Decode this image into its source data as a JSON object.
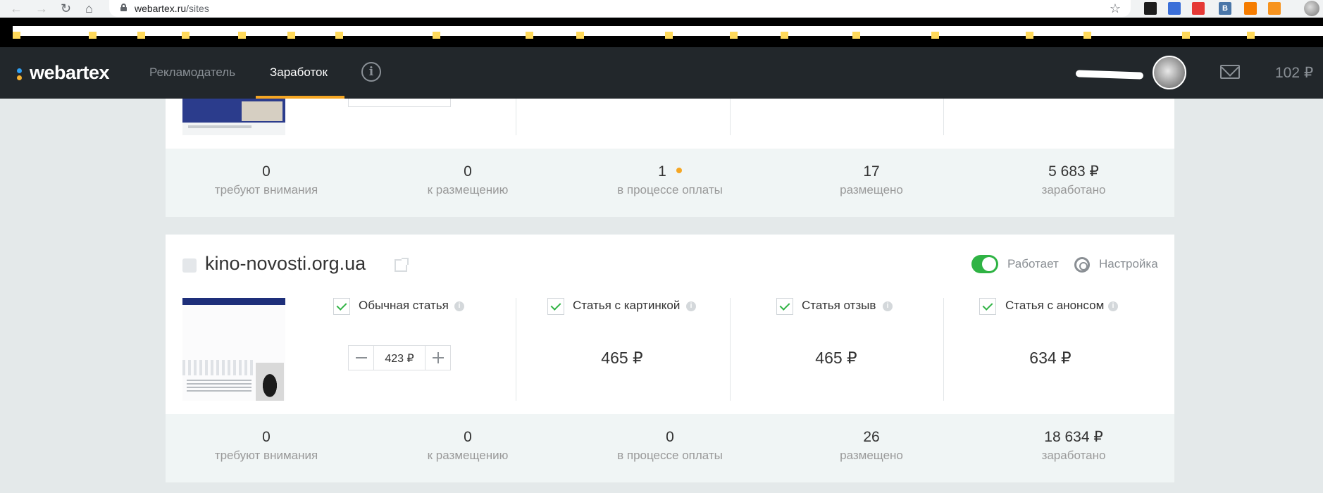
{
  "browser": {
    "url_host": "webartex.ru",
    "url_path": "/sites",
    "back_icon": "arrow-left-icon",
    "forward_icon": "arrow-right-icon",
    "reload_icon": "reload-icon",
    "home_icon": "home-icon",
    "star_icon": "star-icon",
    "extensions": [
      {
        "label": "",
        "color": "#1d1d1d"
      },
      {
        "label": "",
        "color": "#3b6fd8"
      },
      {
        "label": "",
        "color": "#e53935"
      },
      {
        "label": "B",
        "color": "#4a76a8"
      },
      {
        "label": "",
        "color": "#f57c00"
      },
      {
        "label": "",
        "color": "#f7931e"
      }
    ]
  },
  "header": {
    "logo": "webartex",
    "nav": [
      {
        "label": "Рекламодатель",
        "active": false
      },
      {
        "label": "Заработок",
        "active": true
      }
    ],
    "info_icon": "i",
    "balance": "102 ₽",
    "colors": {
      "background": "#22272b",
      "accent": "#f5a623"
    }
  },
  "sites": [
    {
      "stats": [
        {
          "value": "0",
          "label": "требуют внимания"
        },
        {
          "value": "0",
          "label": "к размещению"
        },
        {
          "value": "1",
          "label": "в процессе оплаты",
          "pending_indicator": true
        },
        {
          "value": "17",
          "label": "размещено"
        },
        {
          "value": "5 683 ₽",
          "label": "заработано"
        }
      ]
    },
    {
      "name": "kino-novosti.org.ua",
      "status_label": "Работает",
      "status_on": true,
      "settings_label": "Настройка",
      "article_types": [
        {
          "label": "Обычная статья",
          "checked": true,
          "price": "423 ₽",
          "editable": true
        },
        {
          "label": "Статья с картинкой",
          "checked": true,
          "price": "465 ₽"
        },
        {
          "label": "Статья отзыв",
          "checked": true,
          "price": "465 ₽"
        },
        {
          "label": "Статья с анонсом",
          "checked": true,
          "price": "634 ₽"
        }
      ],
      "stats": [
        {
          "value": "0",
          "label": "требуют внимания"
        },
        {
          "value": "0",
          "label": "к размещению"
        },
        {
          "value": "0",
          "label": "в процессе оплаты"
        },
        {
          "value": "26",
          "label": "размещено"
        },
        {
          "value": "18 634 ₽",
          "label": "заработано"
        }
      ]
    }
  ]
}
